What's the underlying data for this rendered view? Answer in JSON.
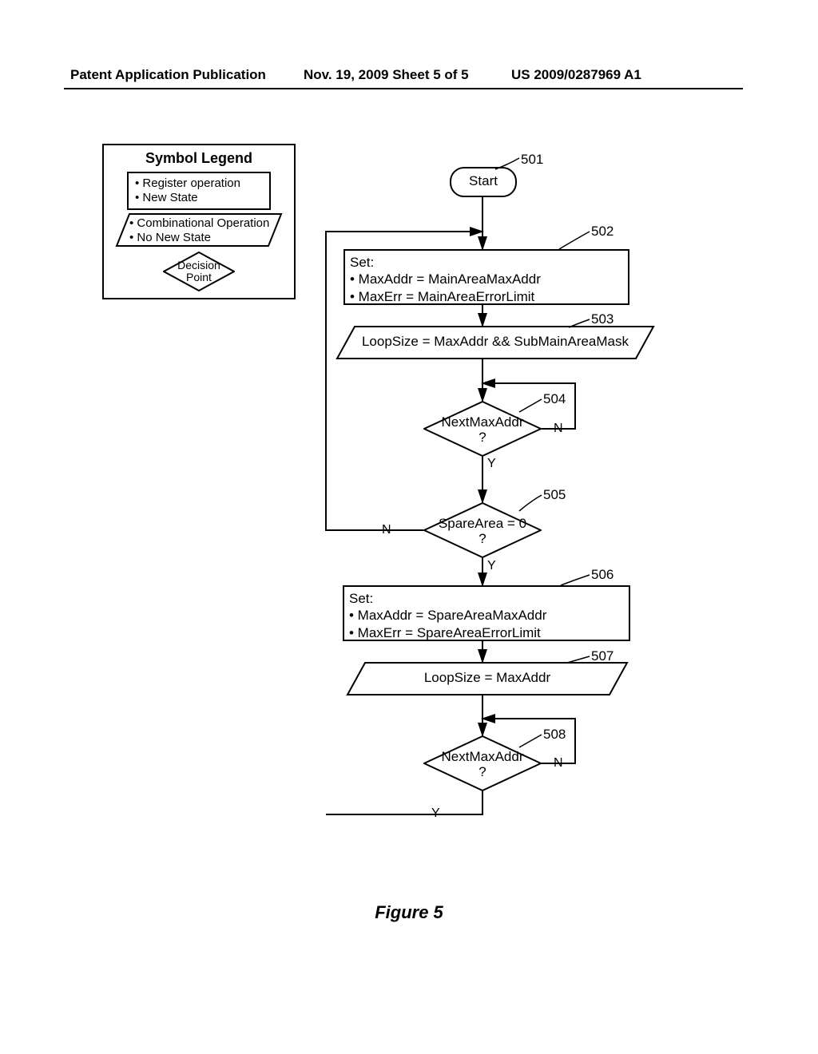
{
  "header": {
    "left": "Patent Application Publication",
    "center": "Nov. 19, 2009  Sheet 5 of 5",
    "right": "US 2009/0287969 A1"
  },
  "legend": {
    "title": "Symbol Legend",
    "rect_line1": "• Register operation",
    "rect_line2": "• New State",
    "para_line1": "• Combinational Operation",
    "para_line2": "• No New State",
    "diamond_line1": "Decision",
    "diamond_line2": "Point"
  },
  "refs": {
    "r501": "501",
    "r502": "502",
    "r503": "503",
    "r504": "504",
    "r505": "505",
    "r506": "506",
    "r507": "507",
    "r508": "508"
  },
  "nodes": {
    "start": "Start",
    "box502_l1": "Set:",
    "box502_l2": " • MaxAddr = MainAreaMaxAddr",
    "box502_l3": " • MaxErr = MainAreaErrorLimit",
    "para503": "LoopSize = MaxAddr && SubMainAreaMask",
    "d504_l1": "NextMaxAddr",
    "d504_l2": "?",
    "d505_l1": "SpareArea = 0",
    "d505_l2": "?",
    "box506_l1": "Set:",
    "box506_l2": " • MaxAddr = SpareAreaMaxAddr",
    "box506_l3": " • MaxErr = SpareAreaErrorLimit",
    "para507": "LoopSize = MaxAddr",
    "d508_l1": "NextMaxAddr",
    "d508_l2": "?"
  },
  "labels": {
    "Y": "Y",
    "N": "N"
  },
  "caption": "Figure 5",
  "chart_data": {
    "type": "flowchart",
    "nodes": [
      {
        "id": 501,
        "type": "terminator",
        "text": "Start"
      },
      {
        "id": 502,
        "type": "process-register",
        "text": "Set: MaxAddr = MainAreaMaxAddr; MaxErr = MainAreaErrorLimit"
      },
      {
        "id": 503,
        "type": "process-combinational",
        "text": "LoopSize = MaxAddr && SubMainAreaMask"
      },
      {
        "id": 504,
        "type": "decision",
        "text": "NextMaxAddr ?"
      },
      {
        "id": 505,
        "type": "decision",
        "text": "SpareArea = 0 ?"
      },
      {
        "id": 506,
        "type": "process-register",
        "text": "Set: MaxAddr = SpareAreaMaxAddr; MaxErr = SpareAreaErrorLimit"
      },
      {
        "id": 507,
        "type": "process-combinational",
        "text": "LoopSize = MaxAddr"
      },
      {
        "id": 508,
        "type": "decision",
        "text": "NextMaxAddr ?"
      }
    ],
    "edges": [
      {
        "from": 501,
        "to": 502
      },
      {
        "from": 502,
        "to": 503
      },
      {
        "from": 503,
        "to": 504
      },
      {
        "from": 504,
        "to": 505,
        "label": "Y"
      },
      {
        "from": 504,
        "to": 504,
        "label": "N",
        "note": "loop back to input of 504"
      },
      {
        "from": 505,
        "to": 506,
        "label": "Y"
      },
      {
        "from": 505,
        "to": 502,
        "label": "N",
        "note": "loop back to input of 502"
      },
      {
        "from": 506,
        "to": 507
      },
      {
        "from": 507,
        "to": 508
      },
      {
        "from": 508,
        "to": 508,
        "label": "N",
        "note": "loop back to input of 508"
      },
      {
        "from": 508,
        "to": 502,
        "label": "Y",
        "note": "loop back to input of 502"
      }
    ]
  }
}
